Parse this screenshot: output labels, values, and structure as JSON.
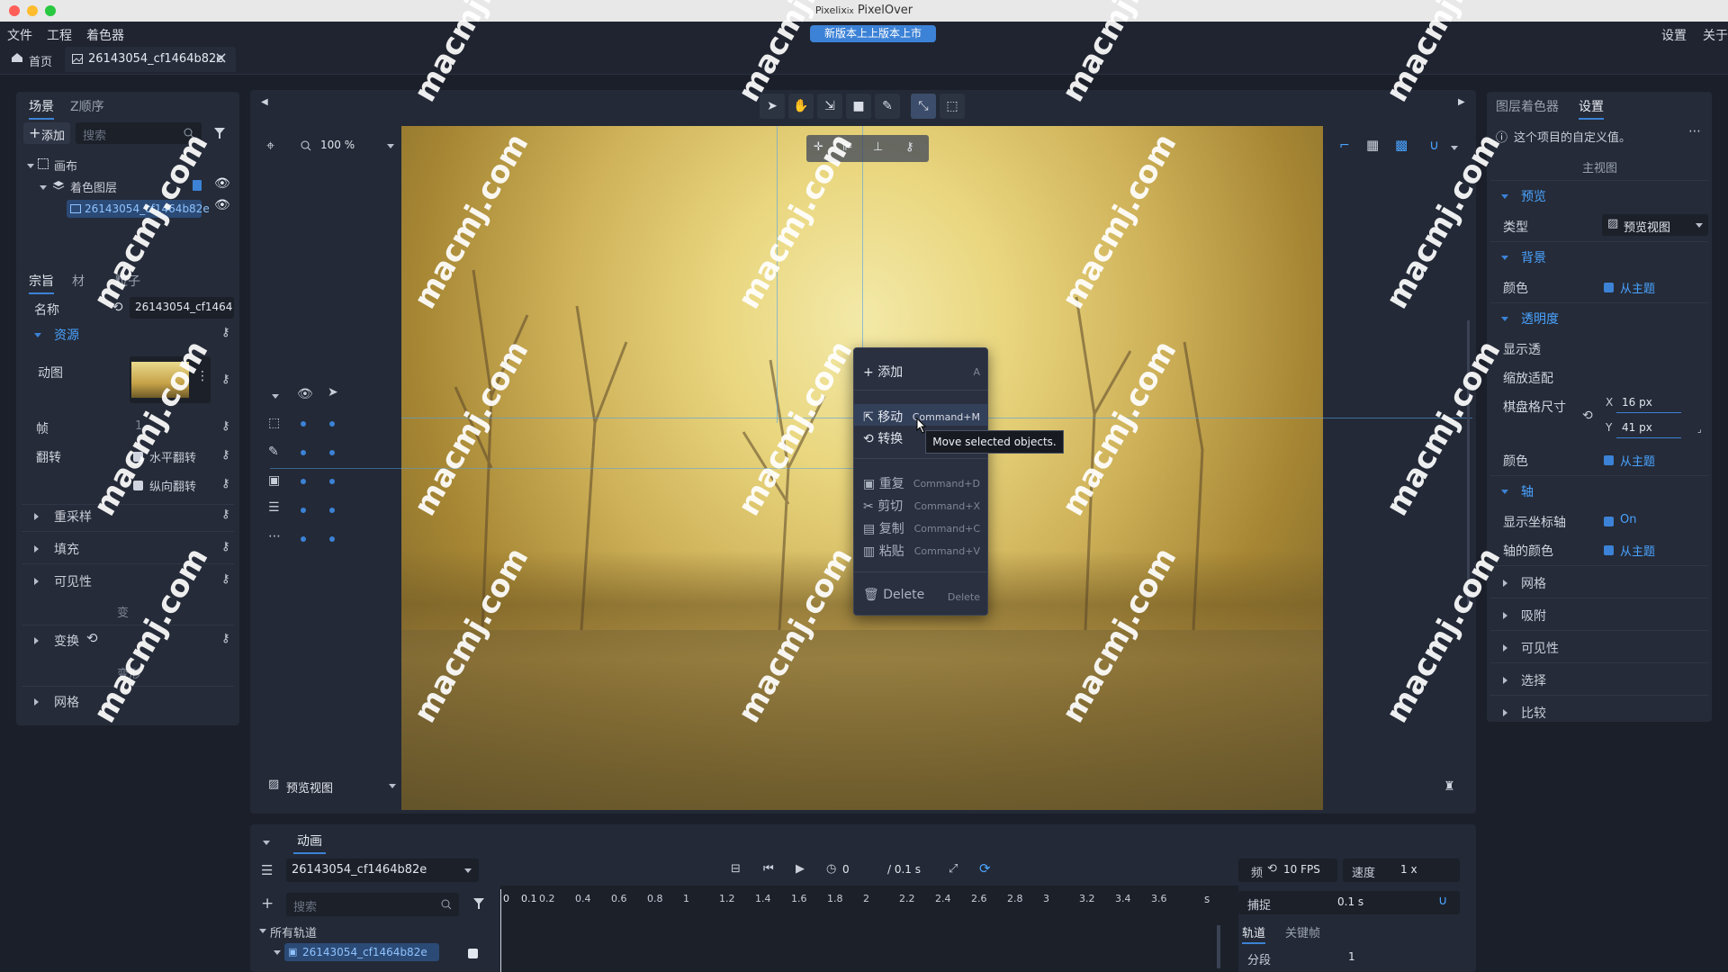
{
  "window": {
    "title": "PixelOver",
    "title_prefix": "Pixelix",
    "title_mid": "ix"
  },
  "menubar": {
    "items": [
      "文件",
      "工程",
      "着色器"
    ],
    "right": [
      "设置",
      "关于"
    ],
    "banner": "新版本上上版本上市"
  },
  "tabs": {
    "home": "首页",
    "file": "26143054_cf1464b82e"
  },
  "left": {
    "scene_tabs": [
      "场景",
      "Z顺序"
    ],
    "add_label": "添加",
    "search_placeholder": "搜索",
    "tree": {
      "canvas": "画布",
      "layer": "着色图层",
      "sprite": "26143054_cf1464b82e"
    },
    "prop_tabs": [
      "宗旨",
      "材",
      "粒子"
    ],
    "name_label": "名称",
    "name_value": "26143054_cf1464",
    "resource_section": "资源",
    "anim_label": "动图",
    "frame_label": "帧",
    "frame_value": "1",
    "flip_label": "翻转",
    "flip_h": "水平翻转",
    "flip_v": "纵向翻转",
    "sections": [
      "重采样",
      "填充",
      "可见性"
    ],
    "change_label": "变",
    "transform_label": "变换",
    "deform_label": "变形",
    "grid_label": "网格"
  },
  "toolbar": {
    "zoom": "100 %",
    "preview_view": "预览视图"
  },
  "context_menu": {
    "add": "添加",
    "add_sc": "A",
    "move": "移动",
    "move_sc": "Command+M",
    "transform": "转换",
    "repeat": "重复",
    "repeat_sc": "Command+D",
    "cut": "剪切",
    "cut_sc": "Command+X",
    "copy": "复制",
    "copy_sc": "Command+C",
    "paste": "粘贴",
    "paste_sc": "Command+V",
    "delete": "Delete",
    "delete_sc": "Delete"
  },
  "tooltip": "Move selected objects.",
  "right": {
    "tabs": [
      "图层着色器",
      "设置"
    ],
    "info": "这个项目的自定义值。",
    "main_view": "主视图",
    "preview_section": "预览",
    "type_label": "类型",
    "type_value": "预览视图",
    "background_section": "背景",
    "color_label": "颜色",
    "from_theme": "从主题",
    "transparency_section": "透明度",
    "show_transparency": "显示透",
    "zoom_fit": "缩放适配",
    "checker_size": "棋盘格尺寸",
    "checker_x_label": "X",
    "checker_x": "16 px",
    "checker_y_label": "Y",
    "checker_y": "41 px",
    "color2_label": "颜色",
    "axis_section": "轴",
    "show_axis": "显示坐标轴",
    "show_axis_value": "On",
    "axis_color": "轴的颜色",
    "collapsed": [
      "网格",
      "吸附",
      "可见性",
      "选择",
      "比较"
    ]
  },
  "animation": {
    "title": "动画",
    "clip": "26143054_cf1464b82e",
    "time": "0",
    "duration": "/ 0.1 s",
    "fps_label": "频",
    "fps": "10 FPS",
    "speed_label": "速度",
    "speed": "1 x",
    "search_placeholder": "搜索",
    "ruler": [
      "0",
      "0.1",
      "0.2",
      "0.4",
      "0.6",
      "0.8",
      "1",
      "1.2",
      "1.4",
      "1.6",
      "1.8",
      "2",
      "2.2",
      "2.4",
      "2.6",
      "2.8",
      "3",
      "3.2",
      "3.4",
      "3.6"
    ],
    "unit": "s",
    "all_tracks": "所有轨道",
    "track": "26143054_cf1464b82e",
    "capture_label": "捕捉",
    "capture_value": "0.1 s",
    "right_tabs": [
      "轨道",
      "关键帧"
    ],
    "segment_label": "分段",
    "segment_value": "1"
  },
  "watermark": "macmj.com",
  "colors": {
    "accent": "#3c82d6",
    "panel": "#252b38",
    "background": "#1b1f2a"
  }
}
